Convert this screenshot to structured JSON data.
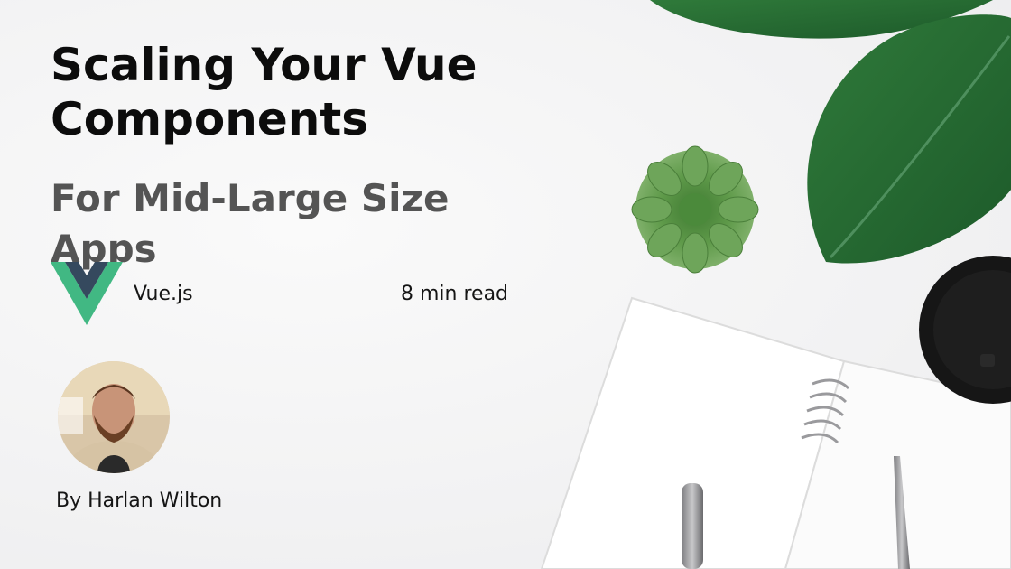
{
  "article": {
    "title": "Scaling Your Vue Components",
    "subtitle": "For Mid-Large Size Apps",
    "tag": "Vue.js",
    "read_time": "8 min read",
    "author": "By Harlan Wilton"
  },
  "icons": {
    "logo": "vue-logo-icon",
    "avatar": "author-avatar"
  },
  "colors": {
    "vue_green": "#41b883",
    "vue_dark": "#35495e",
    "title": "#0c0c0c",
    "subtitle": "#545454"
  }
}
